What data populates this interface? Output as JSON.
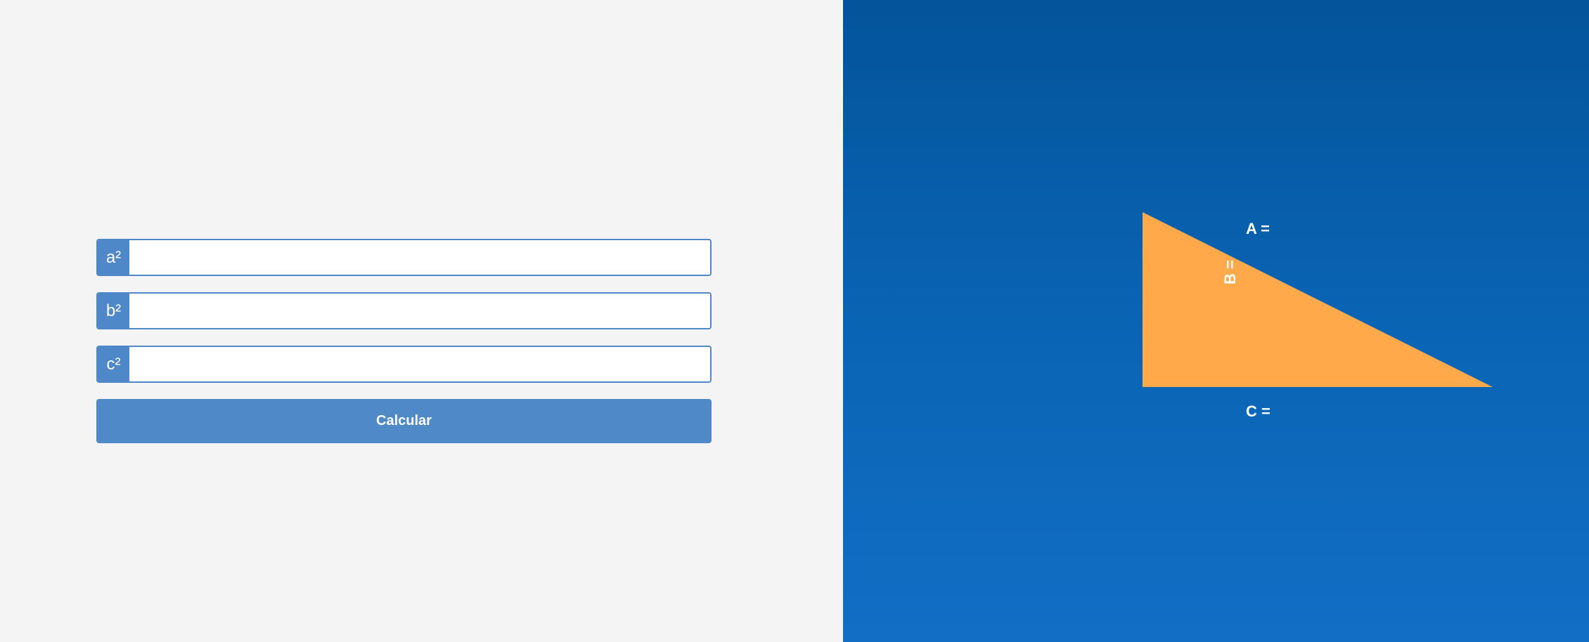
{
  "form": {
    "fields": [
      {
        "label": "a²",
        "value": "",
        "placeholder": ""
      },
      {
        "label": "b²",
        "value": "",
        "placeholder": ""
      },
      {
        "label": "c²",
        "value": "",
        "placeholder": ""
      }
    ],
    "submit_label": "Calcular"
  },
  "diagram": {
    "label_a": "A =",
    "label_b": "B =",
    "label_c": "C =",
    "triangle_color": "#ffa94a"
  },
  "colors": {
    "accent": "#4f88c8",
    "left_background": "#f4f4f5",
    "right_background_top": "#03549a",
    "right_background_bottom": "#116ec4"
  }
}
